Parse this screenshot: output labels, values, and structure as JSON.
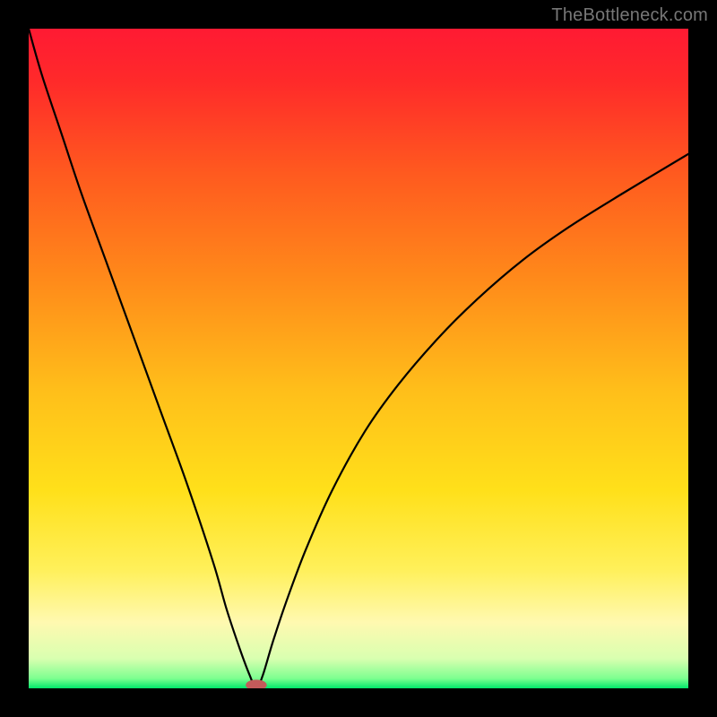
{
  "watermark": "TheBottleneck.com",
  "chart_data": {
    "type": "line",
    "title": "",
    "xlabel": "",
    "ylabel": "",
    "xlim": [
      0,
      100
    ],
    "ylim": [
      0,
      100
    ],
    "gradient_stops": [
      {
        "offset": 0.0,
        "color": "#ff1a33"
      },
      {
        "offset": 0.08,
        "color": "#ff2a2a"
      },
      {
        "offset": 0.22,
        "color": "#ff5a1f"
      },
      {
        "offset": 0.38,
        "color": "#ff8a1a"
      },
      {
        "offset": 0.55,
        "color": "#ffbf1a"
      },
      {
        "offset": 0.7,
        "color": "#ffe01a"
      },
      {
        "offset": 0.82,
        "color": "#fff05a"
      },
      {
        "offset": 0.9,
        "color": "#fff9b0"
      },
      {
        "offset": 0.955,
        "color": "#d9ffb0"
      },
      {
        "offset": 0.985,
        "color": "#7dff90"
      },
      {
        "offset": 1.0,
        "color": "#00e66a"
      }
    ],
    "curve": {
      "x": [
        0,
        2,
        5,
        8,
        12,
        16,
        20,
        24,
        28,
        30,
        32,
        33.5,
        34.5,
        35.5,
        37,
        39,
        42,
        46,
        51,
        56,
        62,
        68,
        75,
        82,
        90,
        100
      ],
      "y": [
        100,
        93,
        84,
        75,
        64,
        53,
        42,
        31,
        19,
        12,
        6,
        2,
        0,
        2,
        7,
        13,
        21,
        30,
        39,
        46,
        53,
        59,
        65,
        70,
        75,
        81
      ]
    },
    "marker": {
      "x": 34.5,
      "y": 0.5,
      "rx": 1.6,
      "ry": 0.8,
      "color": "#c45a5a"
    }
  }
}
